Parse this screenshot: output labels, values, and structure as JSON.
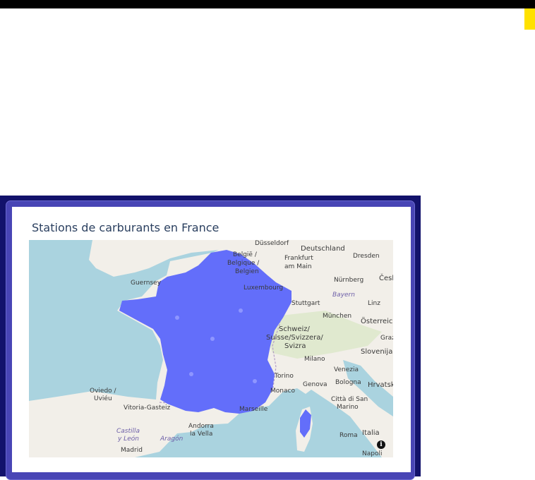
{
  "page": {
    "accent_yellow": "#ffe100",
    "panel_color": "#12126b",
    "frame_color": "#4845b5"
  },
  "card": {
    "title": "Stations de carburants en France"
  },
  "map": {
    "marker_color": "#636efa",
    "water_color": "#aad3df",
    "land_color": "#f2efe9",
    "info_icon": "info-icon",
    "info_symbol": "i",
    "place_labels": [
      "Düsseldorf",
      "Deutschland",
      "België /",
      "Belgique /",
      "Belgien",
      "Frankfurt",
      "am Main",
      "Dresden",
      "Nürnberg",
      "Luxembourg",
      "Bayern",
      "Stuttgart",
      "Linz",
      "München",
      "Österreich",
      "Schweiz/",
      "Suisse/Svizzera/",
      "Svizra",
      "Graz",
      "Slovenija",
      "Milano",
      "Venezia",
      "Torino",
      "Genova",
      "Bologna",
      "Hrvatska",
      "Monaco",
      "Città di San",
      "Marino",
      "Oviedo /",
      "Uviéu",
      "Vitoria-Gasteiz",
      "Marseille",
      "Andorra",
      "la Vella",
      "Castilla",
      "y León",
      "Aragón",
      "Roma",
      "Italia",
      "Madrid",
      "Napoli",
      "Guernsey",
      "Česko"
    ]
  }
}
